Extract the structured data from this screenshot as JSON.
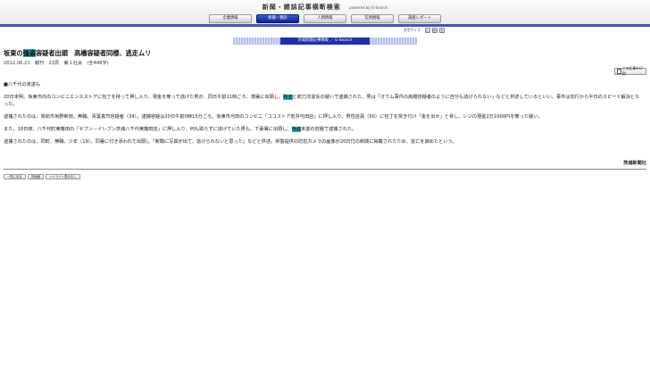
{
  "header": {
    "title": "新聞・雑誌記事横断検索",
    "powered_by": "powered by G-Search"
  },
  "tabs": [
    {
      "label": "企業情報",
      "active": false
    },
    {
      "label": "新聞・雑誌",
      "active": true
    },
    {
      "label": "人物情報",
      "active": false
    },
    {
      "label": "信用情報",
      "active": false
    },
    {
      "label": "調査レポート",
      "active": false
    }
  ],
  "font_size": {
    "label": "文字サイズ",
    "options": [
      "小",
      "中",
      "大"
    ]
  },
  "banner": {
    "text": "茨城新聞記事情報 ／ G-Search"
  },
  "article": {
    "title_pre": "坂東の",
    "title_hl": "強盗",
    "title_post": "容疑者出頭　高橋容疑者同様、逃走ムリ",
    "meta": "2012.06.21　朝刊　23頁　第１社会　(全448字)",
    "save_label": "この記事を印刷",
    "paragraphs": [
      "■八千代の未遂も",
      {
        "pre": "20日未明、坂東市内のコンビニエンスストアに包丁を持って押し入り、現金を奪って逃げた男が、同日午前11時ごろ、境署に出頭し、",
        "hl": "強盗",
        "post": "と銃刀法違反の疑いで逮捕された。男は「オウム事件の高橋容疑者のように自分も逃げられない」などと供述しているといい、事件は犯行から半日のスピード解決となった。"
      },
      "逮捕されたのは、常総市坂野新田、無職、青葉真司容疑者（34）。逮捕容疑は20日午前0時15分ごろ、坂東市弓田のコンビニ「ココストア岩井弓田店」に押し入り、男性店員（50）に包丁を突き付け「金を出せ」と脅し、レジの現金2万1000円を奪った疑い。",
      {
        "pre": "また、18日夜、八千代町東蕗田の「セブン－イレブン茨城八千代東蕗田店」に押し入り、何も取らずに逃げていた男も、下妻署に出頭し、",
        "hl": "強盗",
        "post": "未遂の容疑で逮捕された。"
      },
      "逮捕されたのは、同町、無職、少年（19）。同署に付き添われて出頭し「新聞に写真が出て、逃げられないと思った」などと供述。県警提供の防犯カメラの画像が20日付の新聞に掲載されたため、逃亡を諦めたという。"
    ],
    "credit": "茨城新聞社"
  },
  "footer_buttons": [
    "一覧に戻る",
    "別画面",
    "ハイライト表示なし"
  ],
  "colors": {
    "active_tab": "#1e2fb0",
    "nav_line": "#4355c2",
    "highlight": "#39b3b3"
  }
}
